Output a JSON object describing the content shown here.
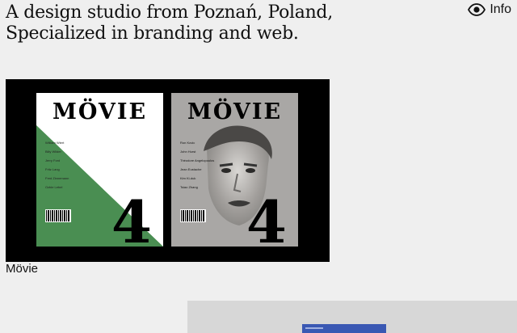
{
  "header": {
    "tagline_line1": "A design studio from Poznań, Poland,",
    "tagline_line2": "Specialized in branding and web.",
    "info_label": "Info",
    "info_icon": "eye-icon"
  },
  "project": {
    "caption": "Mövie",
    "covers": [
      {
        "title": "MÖVIE",
        "issue": "4",
        "names": [
          "William Wiert",
          "Billy Wilder",
          "Jerry Ford",
          "Fritz Lang",
          "Fred Zinnemann",
          "Ozbie Lebel"
        ],
        "colors": {
          "background": "#ffffff",
          "accent": "#4a8e52"
        }
      },
      {
        "title": "MÖVIE",
        "issue": "4",
        "names": [
          "Ron Kovic",
          "John Hurst",
          "Théodore Angelopoulos",
          "Jean Eustache",
          "Kim Ki-duk",
          "Tsiao Zhang"
        ],
        "colors": {
          "background": "#a9a7a5"
        }
      }
    ]
  },
  "colors": {
    "page_background": "#efefef",
    "card_background": "#000000",
    "next_project_background": "#d7d7d7",
    "next_project_accent": "#3a58b3"
  }
}
